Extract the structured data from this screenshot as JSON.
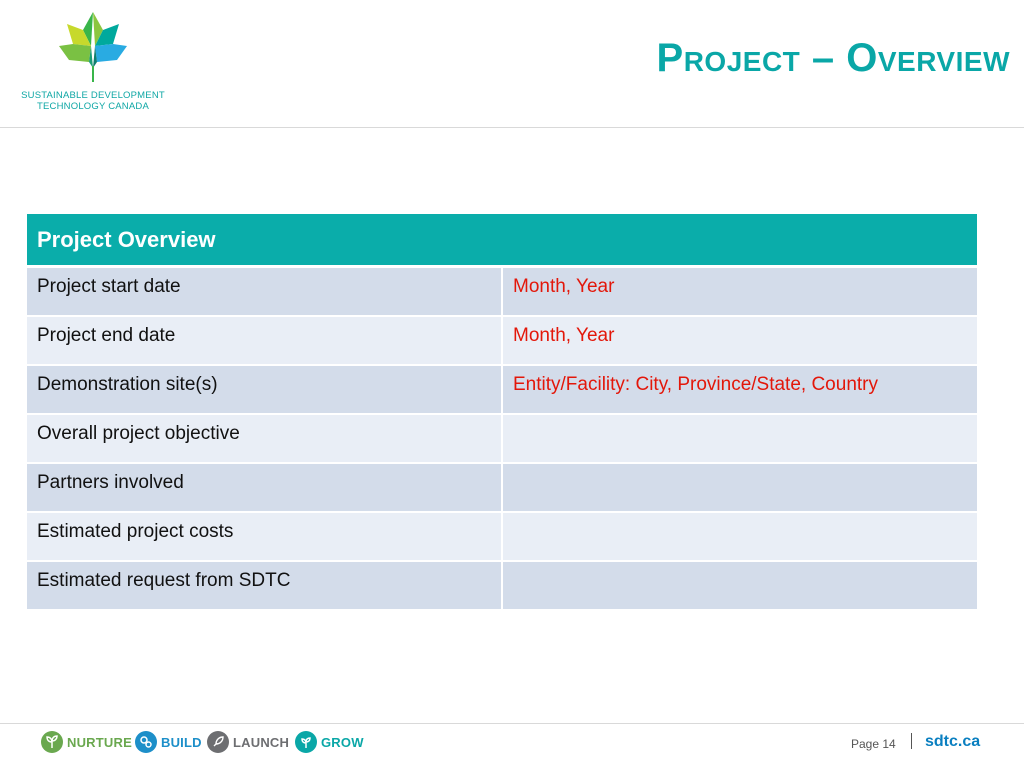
{
  "header": {
    "logo": {
      "icon": "maple-leaf-icon",
      "line1": "SUSTAINABLE DEVELOPMENT",
      "line2": "TECHNOLOGY CANADA"
    },
    "title": "Project – Overview"
  },
  "table": {
    "heading": "Project Overview",
    "rows": [
      {
        "label": "Project start date",
        "value": "Month, Year"
      },
      {
        "label": "Project end date",
        "value": "Month, Year"
      },
      {
        "label": "Demonstration site(s)",
        "value": "Entity/Facility: City, Province/State, Country"
      },
      {
        "label": "Overall project objective",
        "value": ""
      },
      {
        "label": "Partners involved",
        "value": ""
      },
      {
        "label": "Estimated project costs",
        "value": ""
      },
      {
        "label": "Estimated request from SDTC",
        "value": ""
      }
    ]
  },
  "footer": {
    "stages": [
      {
        "label": "NURTURE",
        "icon": "sprout-icon",
        "color": "#6aa84f"
      },
      {
        "label": "BUILD",
        "icon": "gears-icon",
        "color": "#1d8fc9"
      },
      {
        "label": "LAUNCH",
        "icon": "rocket-icon",
        "color": "#6d6e71"
      },
      {
        "label": "GROW",
        "icon": "plant-icon",
        "color": "#0aa7a7"
      }
    ],
    "page_label": "Page 14",
    "site": "sdtc.ca"
  },
  "colors": {
    "accent": "#0aadaa",
    "row_dark": "#d3dcea",
    "row_light": "#e9eef6",
    "placeholder_red": "#e3170a"
  }
}
